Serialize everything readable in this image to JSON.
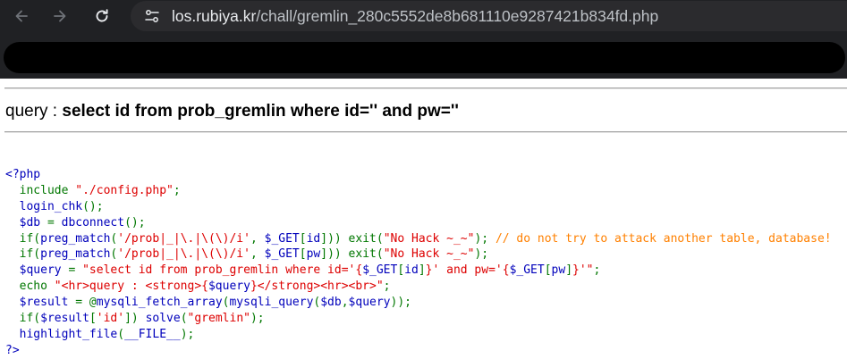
{
  "browser": {
    "url_host": "los.rubiya.kr",
    "url_path": "/chall/gremlin_280c5552de8b681110e9287421b834fd.php"
  },
  "colors": {
    "php_default": "#0000BB",
    "php_keyword": "#007700",
    "php_string": "#DD0000",
    "php_comment": "#FF8000"
  },
  "page": {
    "query_label": "query : ",
    "query_text": "select id from prob_gremlin where id='' and pw=''"
  },
  "source": [
    [
      [
        "v",
        "<?php"
      ]
    ],
    [
      [
        "k",
        "  include "
      ],
      [
        "s",
        "\"./config.php\""
      ],
      [
        "k",
        ";"
      ]
    ],
    [
      [
        "k",
        "  "
      ],
      [
        "v",
        "login_chk"
      ],
      [
        "k",
        "();"
      ]
    ],
    [
      [
        "k",
        "  "
      ],
      [
        "v",
        "$db "
      ],
      [
        "k",
        "= "
      ],
      [
        "v",
        "dbconnect"
      ],
      [
        "k",
        "();"
      ]
    ],
    [
      [
        "k",
        "  if("
      ],
      [
        "v",
        "preg_match"
      ],
      [
        "k",
        "("
      ],
      [
        "s",
        "'/prob|_|\\.|\\(\\)/i'"
      ],
      [
        "k",
        ", "
      ],
      [
        "v",
        "$_GET"
      ],
      [
        "k",
        "["
      ],
      [
        "v",
        "id"
      ],
      [
        "k",
        "])) exit("
      ],
      [
        "s",
        "\"No Hack ~_~\""
      ],
      [
        "k",
        "); "
      ],
      [
        "c",
        "// do not try to attack another table, database!"
      ]
    ],
    [
      [
        "k",
        "  if("
      ],
      [
        "v",
        "preg_match"
      ],
      [
        "k",
        "("
      ],
      [
        "s",
        "'/prob|_|\\.|\\(\\)/i'"
      ],
      [
        "k",
        ", "
      ],
      [
        "v",
        "$_GET"
      ],
      [
        "k",
        "["
      ],
      [
        "v",
        "pw"
      ],
      [
        "k",
        "])) exit("
      ],
      [
        "s",
        "\"No Hack ~_~\""
      ],
      [
        "k",
        ");"
      ]
    ],
    [
      [
        "k",
        "  "
      ],
      [
        "v",
        "$query "
      ],
      [
        "k",
        "= "
      ],
      [
        "s",
        "\"select id from prob_gremlin where id='{"
      ],
      [
        "v",
        "$_GET"
      ],
      [
        "k",
        "["
      ],
      [
        "v",
        "id"
      ],
      [
        "k",
        "]"
      ],
      [
        "s",
        "}' and pw='{"
      ],
      [
        "v",
        "$_GET"
      ],
      [
        "k",
        "["
      ],
      [
        "v",
        "pw"
      ],
      [
        "k",
        "]"
      ],
      [
        "s",
        "}'\""
      ],
      [
        "k",
        ";"
      ]
    ],
    [
      [
        "k",
        "  echo "
      ],
      [
        "s",
        "\"<hr>query : <strong>{"
      ],
      [
        "v",
        "$query"
      ],
      [
        "s",
        "}</strong><hr><br>\""
      ],
      [
        "k",
        ";"
      ]
    ],
    [
      [
        "k",
        "  "
      ],
      [
        "v",
        "$result "
      ],
      [
        "k",
        "= @"
      ],
      [
        "v",
        "mysqli_fetch_array"
      ],
      [
        "k",
        "("
      ],
      [
        "v",
        "mysqli_query"
      ],
      [
        "k",
        "("
      ],
      [
        "v",
        "$db"
      ],
      [
        "k",
        ","
      ],
      [
        "v",
        "$query"
      ],
      [
        "k",
        "));"
      ]
    ],
    [
      [
        "k",
        "  if("
      ],
      [
        "v",
        "$result"
      ],
      [
        "k",
        "["
      ],
      [
        "s",
        "'id'"
      ],
      [
        "k",
        "]) "
      ],
      [
        "v",
        "solve"
      ],
      [
        "k",
        "("
      ],
      [
        "s",
        "\"gremlin\""
      ],
      [
        "k",
        ");"
      ]
    ],
    [
      [
        "k",
        "  "
      ],
      [
        "v",
        "highlight_file"
      ],
      [
        "k",
        "("
      ],
      [
        "v",
        "__FILE__"
      ],
      [
        "k",
        ");"
      ]
    ],
    [
      [
        "v",
        "?>"
      ]
    ]
  ]
}
